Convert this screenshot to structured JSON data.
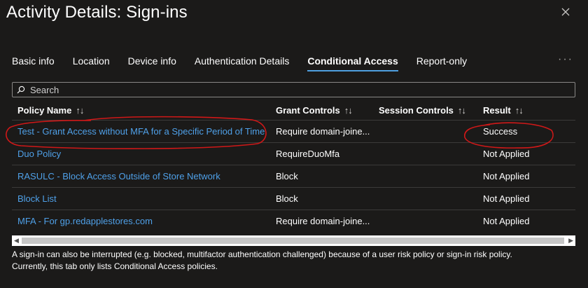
{
  "window": {
    "title": "Activity Details: Sign-ins"
  },
  "tabs": [
    {
      "label": "Basic info"
    },
    {
      "label": "Location"
    },
    {
      "label": "Device info"
    },
    {
      "label": "Authentication Details"
    },
    {
      "label": "Conditional Access",
      "active": true
    },
    {
      "label": "Report-only"
    }
  ],
  "more_label": "···",
  "search": {
    "placeholder": "Search",
    "value": ""
  },
  "table": {
    "columns": [
      "Policy Name",
      "Grant Controls",
      "Session Controls",
      "Result"
    ],
    "sort_glyph": "↑↓",
    "rows": [
      {
        "policy": "Test - Grant Access without MFA for a Specific Period of Time",
        "grant": "Require domain-joine...",
        "session": "",
        "result": "Success"
      },
      {
        "policy": "Duo Policy",
        "grant": "RequireDuoMfa",
        "session": "",
        "result": "Not Applied"
      },
      {
        "policy": "RASULC - Block Access Outside of Store Network",
        "grant": "Block",
        "session": "",
        "result": "Not Applied"
      },
      {
        "policy": "Block List",
        "grant": "Block",
        "session": "",
        "result": "Not Applied"
      },
      {
        "policy": "MFA - For gp.redapplestores.com",
        "grant": "Require domain-joine...",
        "session": "",
        "result": "Not Applied"
      }
    ]
  },
  "scroll": {
    "left_arrow": "◀",
    "right_arrow": "▶"
  },
  "footer": {
    "line1": "A sign-in can also be interrupted (e.g. blocked, multifactor authentication challenged) because of a user risk policy or sign-in risk policy.",
    "line2": "Currently, this tab only lists Conditional Access policies."
  },
  "colors": {
    "background": "#1b1a19",
    "link": "#4fa0e8",
    "accent": "#4f9fe0",
    "annotation": "#d01818"
  }
}
